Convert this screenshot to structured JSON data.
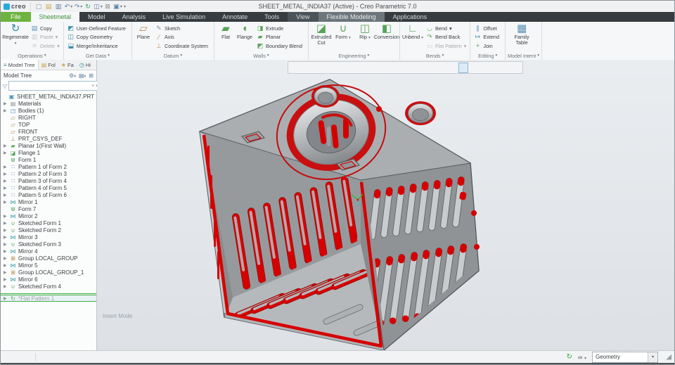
{
  "window": {
    "title": "SHEET_METAL_INDIA37 (Active) - Creo Parametric 7.0",
    "logo_text": "creo",
    "controls": [
      {
        "name": "minimize-button",
        "glyph": "–"
      },
      {
        "name": "maximize-button",
        "glyph": "▢"
      },
      {
        "name": "close-button",
        "glyph": "✕"
      }
    ],
    "tabbar_right": [
      {
        "name": "collapse-ribbon-icon",
        "glyph": "ˆ"
      },
      {
        "name": "user-icon",
        "glyph": "♟",
        "color": "#c9806a"
      },
      {
        "name": "help-icon",
        "glyph": "?"
      }
    ]
  },
  "quick_access": [
    {
      "name": "new-file-button",
      "glyph": "▢",
      "color": "#8d9094"
    },
    {
      "name": "open-file-button",
      "glyph": "▤",
      "color": "#caa54a"
    },
    {
      "name": "save-button",
      "glyph": "▥",
      "color": "#5b80a8"
    },
    {
      "name": "undo-button",
      "glyph": "↶",
      "dd": "▾",
      "color": "#5b80a8"
    },
    {
      "name": "redo-button",
      "glyph": "↷",
      "dd": "▾",
      "color": "#5b80a8"
    },
    {
      "name": "regenerate-quick-button",
      "glyph": "↻",
      "color": "#2e9e6b"
    },
    {
      "name": "model-display-button",
      "glyph": "◫",
      "dd": "▾",
      "color": "#5b80a8"
    },
    {
      "name": "close-window-button",
      "glyph": "⊠",
      "color": "#8d9094"
    },
    {
      "name": "windows-button",
      "glyph": "▣",
      "dd": "▾",
      "color": "#5b80a8"
    }
  ],
  "ribbon_tabs": [
    {
      "label": "File",
      "name": "tab-file",
      "cls": "file"
    },
    {
      "label": "Sheetmetal",
      "name": "tab-sheetmetal",
      "cls": "active"
    },
    {
      "label": "Model",
      "name": "tab-model"
    },
    {
      "label": "Analysis",
      "name": "tab-analysis"
    },
    {
      "label": "Live Simulation",
      "name": "tab-live-simulation"
    },
    {
      "label": "Annotate",
      "name": "tab-annotate"
    },
    {
      "label": "Tools",
      "name": "tab-tools"
    },
    {
      "label": "View",
      "name": "tab-view",
      "cls": "shade1"
    },
    {
      "label": "Flexible Modeling",
      "name": "tab-flexible-modeling",
      "cls": "shade2"
    },
    {
      "label": "Applications",
      "name": "tab-applications"
    }
  ],
  "glyphs": {
    "dd": "▾"
  },
  "ribbon": {
    "groups": [
      {
        "label": "Operations",
        "big": [
          {
            "label": "Regenerate",
            "name": "regenerate-button",
            "glyph": "↻",
            "color": "#2e86a0",
            "dd": "▾"
          }
        ],
        "small": [
          {
            "label": "Copy",
            "name": "copy-button",
            "glyph": "▤",
            "color": "#5b8fb5"
          },
          {
            "label": "Paste",
            "name": "paste-button",
            "glyph": "▥",
            "color": "#8d9094",
            "dd": "▾",
            "cls": "disabled"
          },
          {
            "label": "Delete",
            "name": "delete-button",
            "glyph": "✕",
            "color": "#8d9094",
            "dd": "▾",
            "cls": "disabled"
          }
        ]
      },
      {
        "label": "Get Data",
        "big": [],
        "small": [
          {
            "label": "User-Defined Feature",
            "name": "user-defined-feature-button",
            "glyph": "◩",
            "color": "#3f8fb0"
          },
          {
            "label": "Copy Geometry",
            "name": "copy-geometry-button",
            "glyph": "◫",
            "color": "#3f8fb0"
          },
          {
            "label": "Merge/Inheritance",
            "name": "merge-inheritance-button",
            "glyph": "⬓",
            "color": "#3f8fb0"
          }
        ]
      },
      {
        "label": "Datum",
        "big": [
          {
            "label": "Plane",
            "name": "plane-button",
            "glyph": "▱",
            "color": "#b08d57"
          }
        ],
        "small": [
          {
            "label": "Sketch",
            "name": "sketch-button",
            "glyph": "✎",
            "color": "#8d9094"
          },
          {
            "label": "Axis",
            "name": "axis-button",
            "glyph": "⁄",
            "color": "#b08d57"
          },
          {
            "label": "Coordinate System",
            "name": "coordinate-system-button",
            "glyph": "⊥",
            "color": "#b08d57"
          }
        ]
      },
      {
        "label": "Walls",
        "big": [
          {
            "label": "Flat",
            "name": "flat-button",
            "glyph": "▰",
            "color": "#57a357"
          },
          {
            "label": "Flange",
            "name": "flange-button",
            "glyph": "◖",
            "color": "#57a357"
          }
        ],
        "small": [
          {
            "label": "Extrude",
            "name": "extrude-button",
            "glyph": "◨",
            "color": "#57a357"
          },
          {
            "label": "Planar",
            "name": "planar-button",
            "glyph": "▰",
            "color": "#57a357"
          },
          {
            "label": "Boundary Blend",
            "name": "boundary-blend-button",
            "glyph": "◩",
            "color": "#57a357"
          }
        ]
      },
      {
        "label": "Engineering",
        "big": [
          {
            "label": "Extruded Cut",
            "name": "extruded-cut-button",
            "glyph": "◪",
            "color": "#57a357"
          },
          {
            "label": "Form",
            "name": "form-button",
            "glyph": "∪",
            "color": "#57a357",
            "dd": "▾"
          },
          {
            "label": "Rip",
            "name": "rip-button",
            "glyph": "◫",
            "color": "#57a357",
            "dd": "▾"
          },
          {
            "label": "Conversion",
            "name": "conversion-button",
            "glyph": "◧",
            "color": "#57a357"
          }
        ],
        "small": []
      },
      {
        "label": "Bends",
        "big": [
          {
            "label": "Unbend",
            "name": "unbend-button",
            "glyph": "∟",
            "color": "#57a357",
            "dd": "▾"
          }
        ],
        "small": [
          {
            "label": "Bend",
            "name": "bend-button",
            "glyph": "◡",
            "color": "#57a357",
            "dd": "▾"
          },
          {
            "label": "Bend Back",
            "name": "bend-back-button",
            "glyph": "↷",
            "color": "#57a357"
          },
          {
            "label": "Flat Pattern",
            "name": "flat-pattern-button",
            "glyph": "▭",
            "color": "#8d9094",
            "dd": "▾",
            "cls": "disabled"
          }
        ]
      },
      {
        "label": "Editing",
        "big": [],
        "small": [
          {
            "label": "Offset",
            "name": "offset-button",
            "glyph": "∥",
            "color": "#3f8fb0"
          },
          {
            "label": "Extend",
            "name": "extend-button",
            "glyph": "↦",
            "color": "#3f8fb0"
          },
          {
            "label": "Join",
            "name": "join-button",
            "glyph": "+",
            "color": "#57a357"
          }
        ]
      },
      {
        "label": "Model Intent",
        "big": [
          {
            "label": "Family Table",
            "name": "family-table-button",
            "glyph": "▦",
            "color": "#5b8fb5"
          }
        ],
        "small": []
      }
    ]
  },
  "left_panel": {
    "tabs": [
      {
        "label": "Model Tree",
        "name": "panel-tab-model-tree",
        "glyph": "≡",
        "color": "#2e86a0",
        "cls": "active"
      },
      {
        "label": "Fol",
        "name": "panel-tab-folder-browser",
        "glyph": "▤",
        "color": "#caa54a"
      },
      {
        "label": "Fa",
        "name": "panel-tab-favorites",
        "glyph": "★",
        "color": "#caa54a"
      },
      {
        "label": "Hi",
        "name": "panel-tab-history",
        "glyph": "◷",
        "color": "#2e86a0"
      }
    ],
    "header": {
      "title": "Model Tree"
    },
    "header_icons": [
      {
        "name": "tree-filters-icon",
        "glyph": "⚙",
        "dd": "▾"
      },
      {
        "name": "tree-settings-icon",
        "glyph": "▤",
        "dd": "▾"
      },
      {
        "name": "show-columns-icon",
        "glyph": "⊞"
      }
    ],
    "search": {
      "placeholder": "",
      "clear_glyph": "×",
      "dd_glyph": "▾",
      "add_glyph": "+",
      "funnel_glyph": "▽"
    },
    "tree": [
      {
        "label": "SHEET_METAL_INDIA37.PRT",
        "name": "tree-item-root",
        "glyph": "▣",
        "color": "#4a90b8",
        "cls": "noarrow root",
        "arrow": ""
      },
      {
        "label": "Materials",
        "name": "tree-item-materials",
        "glyph": "▤",
        "color": "#8d9094",
        "arrow": "▶"
      },
      {
        "label": "Bodies (1)",
        "name": "tree-item-bodies",
        "glyph": "◳",
        "color": "#4a90b8",
        "arrow": "▶"
      },
      {
        "label": "RIGHT",
        "name": "tree-item-right",
        "glyph": "▱",
        "color": "#b08d57",
        "cls": "noarrow",
        "arrow": ""
      },
      {
        "label": "TOP",
        "name": "tree-item-top",
        "glyph": "▱",
        "color": "#b08d57",
        "cls": "noarrow",
        "arrow": ""
      },
      {
        "label": "FRONT",
        "name": "tree-item-front",
        "glyph": "▱",
        "color": "#b08d57",
        "cls": "noarrow",
        "arrow": ""
      },
      {
        "label": "PRT_CSYS_DEF",
        "name": "tree-item-prt-csys-def",
        "glyph": "⊥",
        "color": "#b08d57",
        "cls": "noarrow",
        "arrow": ""
      },
      {
        "label": "Planar 1(First Wall)",
        "name": "tree-item-planar-1",
        "glyph": "▰",
        "color": "#57a357",
        "arrow": "▶"
      },
      {
        "label": "Flange 1",
        "name": "tree-item-flange-1",
        "glyph": "◪",
        "color": "#57a357",
        "arrow": "▶"
      },
      {
        "label": "Form 1",
        "name": "tree-item-form-1",
        "glyph": "⋓",
        "color": "#57a357",
        "cls": "noarrow",
        "arrow": ""
      },
      {
        "label": "Pattern 1 of Form 2",
        "name": "tree-item-pattern-1",
        "glyph": "∷",
        "color": "#4a78c0",
        "arrow": "▶"
      },
      {
        "label": "Pattern 2 of Form 3",
        "name": "tree-item-pattern-2",
        "glyph": "∷",
        "color": "#4a78c0",
        "arrow": "▶"
      },
      {
        "label": "Pattern 3 of Form 4",
        "name": "tree-item-pattern-3",
        "glyph": "∷",
        "color": "#4a78c0",
        "arrow": "▶"
      },
      {
        "label": "Pattern 4 of Form 5",
        "name": "tree-item-pattern-4",
        "glyph": "∷",
        "color": "#4a78c0",
        "arrow": "▶"
      },
      {
        "label": "Pattern 5 of Form 6",
        "name": "tree-item-pattern-5",
        "glyph": "∷",
        "color": "#4a78c0",
        "arrow": "▶"
      },
      {
        "label": "Mirror 1",
        "name": "tree-item-mirror-1",
        "glyph": "⋈",
        "color": "#38a0a8",
        "arrow": "▶"
      },
      {
        "label": "Form 7",
        "name": "tree-item-form-7",
        "glyph": "⋓",
        "color": "#57a357",
        "cls": "noarrow",
        "arrow": ""
      },
      {
        "label": "Mirror 2",
        "name": "tree-item-mirror-2",
        "glyph": "⋈",
        "color": "#38a0a8",
        "arrow": "▶"
      },
      {
        "label": "Sketched Form 1",
        "name": "tree-item-sketched-form-1",
        "glyph": "∪",
        "color": "#57a357",
        "arrow": "▶"
      },
      {
        "label": "Sketched Form 2",
        "name": "tree-item-sketched-form-2",
        "glyph": "∪",
        "color": "#57a357",
        "arrow": "▶"
      },
      {
        "label": "Mirror 3",
        "name": "tree-item-mirror-3",
        "glyph": "⋈",
        "color": "#38a0a8",
        "arrow": "▶"
      },
      {
        "label": "Sketched Form 3",
        "name": "tree-item-sketched-form-3",
        "glyph": "∪",
        "color": "#57a357",
        "arrow": "▶"
      },
      {
        "label": "Mirror 4",
        "name": "tree-item-mirror-4",
        "glyph": "⋈",
        "color": "#38a0a8",
        "arrow": "▶"
      },
      {
        "label": "Group LOCAL_GROUP",
        "name": "tree-item-group-local-group",
        "glyph": "⊞",
        "color": "#b5893c",
        "arrow": "▶"
      },
      {
        "label": "Mirror 5",
        "name": "tree-item-mirror-5",
        "glyph": "⋈",
        "color": "#38a0a8",
        "arrow": "▶"
      },
      {
        "label": "Group LOCAL_GROUP_1",
        "name": "tree-item-group-local-group-1",
        "glyph": "⊞",
        "color": "#b5893c",
        "arrow": "▶"
      },
      {
        "label": "Mirror 6",
        "name": "tree-item-mirror-6",
        "glyph": "⋈",
        "color": "#38a0a8",
        "arrow": "▶"
      },
      {
        "label": "Sketched Form 4",
        "name": "tree-item-sketched-form-4",
        "glyph": "∪",
        "color": "#57a357",
        "arrow": "▶"
      },
      {
        "cls": "sep",
        "name": "insert-indicator",
        "interactable": "false",
        "label": "",
        "arrow": ""
      },
      {
        "label": "*Flat Pattern 1",
        "name": "tree-item-flat-pattern-1",
        "glyph": "↻",
        "color": "#57a357",
        "cls": "grayed selected",
        "arrow": "▶"
      }
    ]
  },
  "viewport": {
    "insert_mode_label": "Insert Mode",
    "toolbar": [
      {
        "name": "refit-icon",
        "glyph": "⊡"
      },
      {
        "name": "zoom-in-icon",
        "glyph": "⊕"
      },
      {
        "name": "zoom-out-icon",
        "glyph": "⊖"
      },
      {
        "name": "repaint-icon",
        "glyph": "◪"
      },
      {
        "name": "shading-icon",
        "glyph": "◧"
      },
      {
        "name": "display-style-icon",
        "glyph": "▣"
      },
      {
        "name": "saved-orientations-icon",
        "glyph": "⌂"
      },
      {
        "name": "view-manager-icon",
        "glyph": "▤"
      },
      {
        "name": "capture-icon",
        "glyph": "◫"
      },
      {
        "name": "perspective-icon",
        "glyph": "◰"
      },
      {
        "name": "appearance-icon",
        "glyph": "◉"
      },
      {
        "name": "section-icon",
        "glyph": "◬"
      },
      {
        "name": "datum-plane-display-icon",
        "glyph": "▱"
      },
      {
        "name": "datum-axis-display-icon",
        "glyph": "∕"
      },
      {
        "name": "datum-point-display-icon",
        "glyph": "∴"
      },
      {
        "name": "datum-csys-display-icon",
        "glyph": "⊥"
      },
      {
        "name": "spin-center-icon",
        "glyph": "+",
        "cls": "active"
      },
      {
        "name": "annotation-display-icon",
        "glyph": "◭"
      },
      {
        "name": "dragger-icon",
        "glyph": "◱"
      },
      {
        "name": "simulate-icon",
        "glyph": "△"
      },
      {
        "name": "pause-icon",
        "glyph": "∥"
      },
      {
        "name": "exit-icon",
        "glyph": "⊣"
      }
    ]
  },
  "status_bar": {
    "left_icons": [
      {
        "name": "toggle-model-tree-icon",
        "glyph": "⊫"
      },
      {
        "name": "web-browser-icon",
        "glyph": "⊕"
      },
      {
        "name": "hidden-items-icon",
        "glyph": "▢"
      }
    ],
    "refresh_icon": "↻",
    "search_icon": "∞",
    "search_dd": "▾",
    "filter": {
      "value": "Geometry",
      "dd": "▾"
    }
  },
  "colors": {
    "red": "#d60000",
    "file-green": "#6db33f",
    "tab-green-text": "#3f8f3f",
    "part-gray": "#a2a5a8",
    "select-line": "#3fae49",
    "accent-teal": "#2e86a0"
  }
}
